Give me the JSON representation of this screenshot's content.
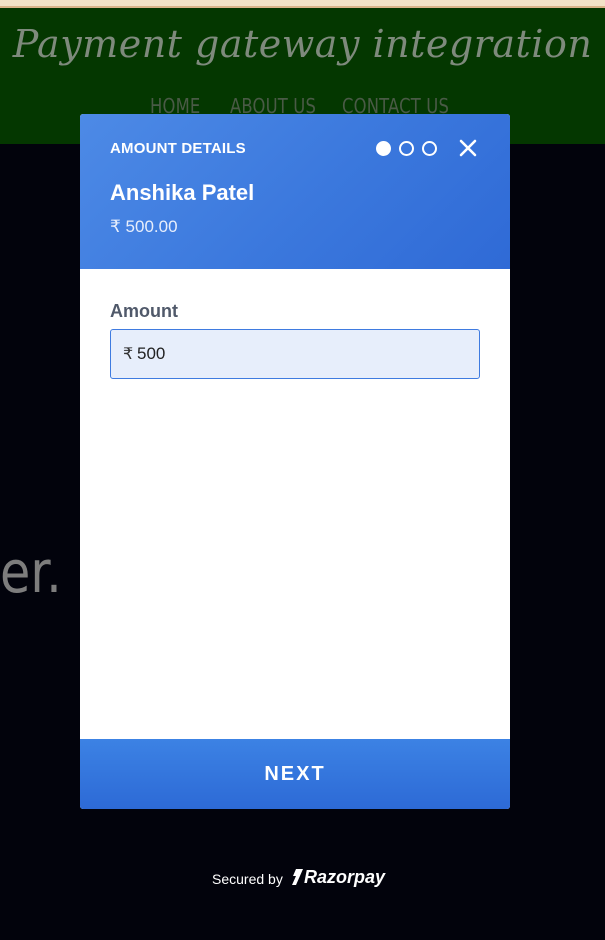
{
  "site": {
    "title": "Payment gateway integration",
    "nav": [
      "HOME",
      "ABOUT US",
      "CONTACT US"
    ],
    "background_text": "er."
  },
  "modal": {
    "header_label": "AMOUNT DETAILS",
    "steps": {
      "current": 1,
      "total": 3
    },
    "close_icon": "close-icon",
    "merchant_name": "Anshika Patel",
    "amount_display": "₹ 500.00",
    "amount_field": {
      "label": "Amount",
      "currency_symbol": "₹",
      "value": "500"
    },
    "next_label": "NEXT"
  },
  "footer": {
    "secured_by": "Secured by",
    "brand": "Razorpay"
  },
  "colors": {
    "accent": "#3b78dd",
    "site_header": "#043700",
    "page_background": "#02030c"
  }
}
